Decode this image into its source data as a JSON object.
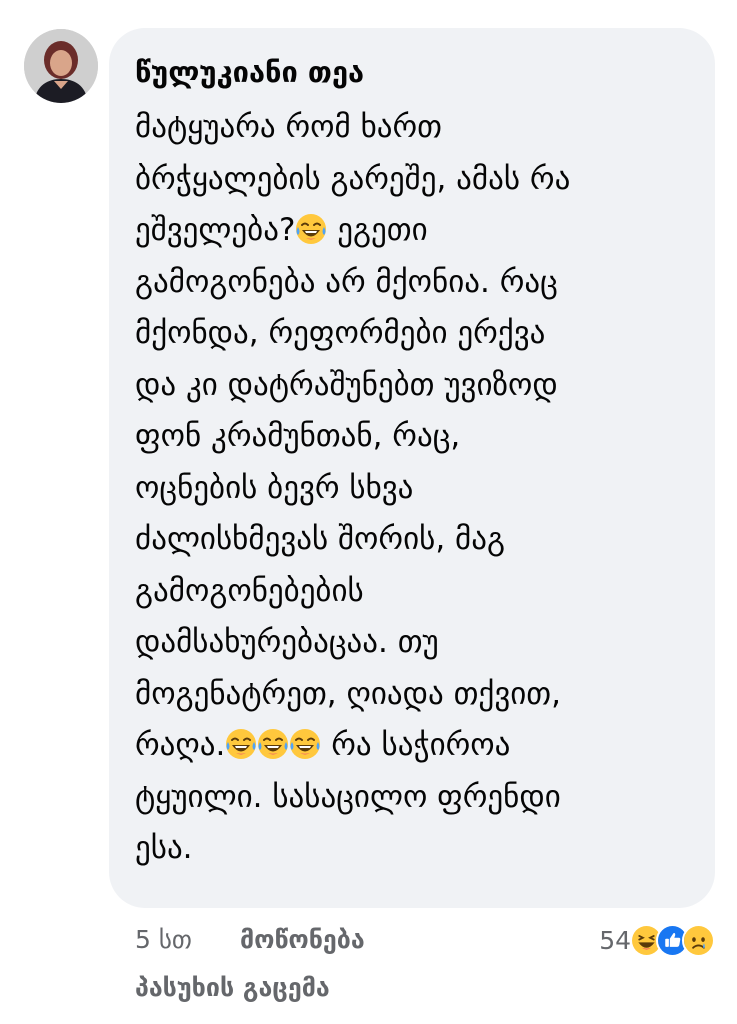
{
  "comment": {
    "author": "წულუკიანი თეა",
    "lines": [
      [
        {
          "t": "მატყუარა რომ ხართ"
        }
      ],
      [
        {
          "t": "ბრჭყალების გარეშე, ამას რა"
        }
      ],
      [
        {
          "t": "ეშველება?"
        },
        {
          "e": "laugh-cry"
        },
        {
          "t": " ეგეთი"
        }
      ],
      [
        {
          "t": "გამოგონება არ მქონია. რაც"
        }
      ],
      [
        {
          "t": "მქონდა, რეფორმები ერქვა"
        }
      ],
      [
        {
          "t": "და კი დატრაშუნებთ უვიზოდ"
        }
      ],
      [
        {
          "t": "ფონ კრამუნთან, რაც,"
        }
      ],
      [
        {
          "t": "ოცნების ბევრ სხვა"
        }
      ],
      [
        {
          "t": "ძალისხმევას შორის, მაგ"
        }
      ],
      [
        {
          "t": "გამოგონებების"
        }
      ],
      [
        {
          "t": "დამსახურებაცაა. თუ"
        }
      ],
      [
        {
          "t": "მოგენატრეთ, ღიადა თქვით,"
        }
      ],
      [
        {
          "t": "რაღა."
        },
        {
          "e": "laugh-cry"
        },
        {
          "e": "laugh-cry"
        },
        {
          "e": "laugh-cry"
        },
        {
          "t": " რა საჭიროა"
        }
      ],
      [
        {
          "t": "ტყუილი. სასაცილო ფრენდი"
        }
      ],
      [
        {
          "t": "ესა."
        }
      ]
    ]
  },
  "meta": {
    "time": "5 სთ",
    "like_label": "მოწონება",
    "reply_label": "პასუხის გაცემა"
  },
  "reactions": {
    "count": "54",
    "icons": [
      "haha-icon",
      "like-icon",
      "sad-icon"
    ]
  },
  "colors": {
    "bubble": "#f0f2f5",
    "meta_text": "#65676b",
    "like_blue": "#1877f2",
    "emoji_yellow": "#ffc83d"
  }
}
